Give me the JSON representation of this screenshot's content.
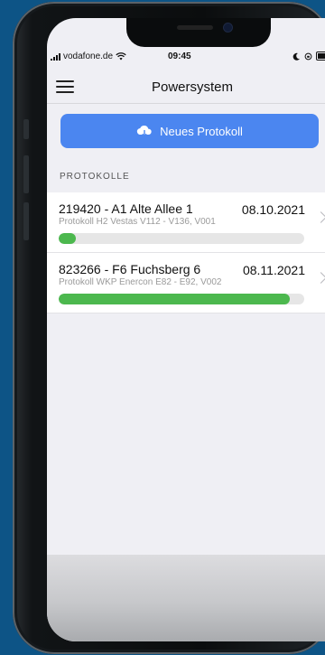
{
  "status_bar": {
    "carrier": "vodafone.de",
    "time": "09:45"
  },
  "nav": {
    "title": "Powersystem",
    "menu_icon": "hamburger-menu-icon"
  },
  "new_protocol_button": {
    "label": "Neues Protokoll",
    "icon": "cloud-download-icon"
  },
  "section": {
    "header": "PROTOKOLLE"
  },
  "protocols": [
    {
      "title": "219420 - A1 Alte Allee 1",
      "date": "08.10.2021",
      "subtitle": "Protokoll H2 Vestas V112 - V136, V001",
      "progress": 0.07
    },
    {
      "title": "823266 - F6 Fuchsberg 6",
      "date": "08.11.2021",
      "subtitle": "Protokoll WKP Enercon E82 - E92, V002",
      "progress": 0.94
    }
  ],
  "colors": {
    "accent": "#4b86f0",
    "progress": "#4cb84e",
    "background": "#0d5486"
  }
}
